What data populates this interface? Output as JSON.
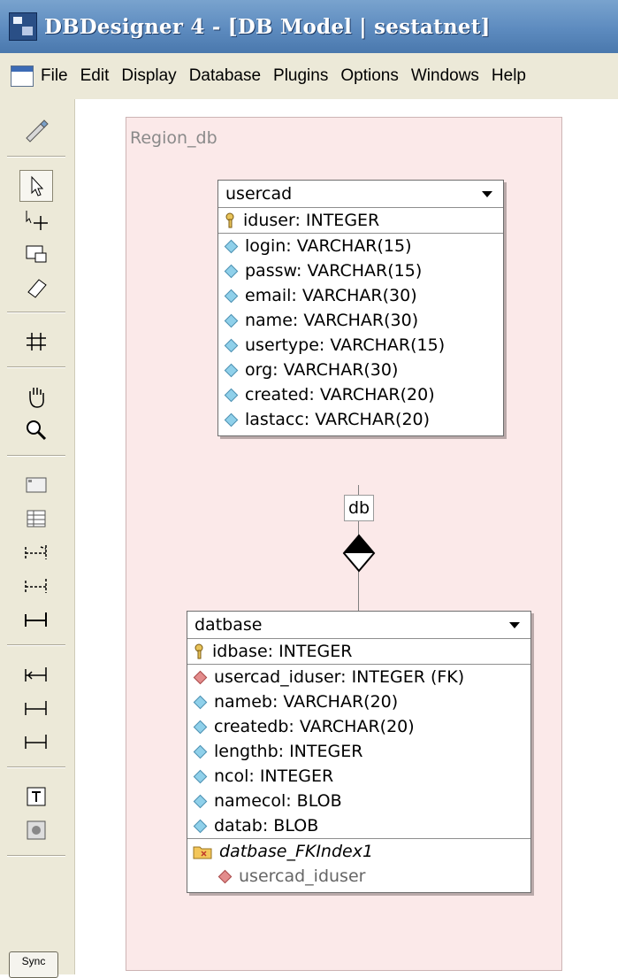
{
  "window": {
    "title": "DBDesigner 4 - [DB Model | sestatnet]"
  },
  "menu": [
    "File",
    "Edit",
    "Display",
    "Database",
    "Plugins",
    "Options",
    "Windows",
    "Help"
  ],
  "toolbar": {
    "tools": [
      "pen-icon",
      "pointer-icon",
      "move-icon",
      "resize-icon",
      "eraser-icon",
      "grid-icon",
      "hand-icon",
      "zoom-icon",
      "region-icon",
      "table-icon",
      "relation-1n-icon",
      "relation-1n-sub-icon",
      "relation-11-icon",
      "relation-nm-icon",
      "relation-1-1-sub-icon",
      "relation-link-icon",
      "note-icon",
      "image-icon"
    ],
    "sync_label": "Sync"
  },
  "region": {
    "label": "Region_db"
  },
  "tables": {
    "usercad": {
      "name": "usercad",
      "pk": "iduser: INTEGER",
      "columns": [
        "login: VARCHAR(15)",
        "passw: VARCHAR(15)",
        "email: VARCHAR(30)",
        "name: VARCHAR(30)",
        "usertype: VARCHAR(15)",
        "org: VARCHAR(30)",
        "created: VARCHAR(20)",
        "lastacc: VARCHAR(20)"
      ]
    },
    "datbase": {
      "name": "datbase",
      "pk": "idbase: INTEGER",
      "fk_column": "usercad_iduser: INTEGER (FK)",
      "columns": [
        "nameb: VARCHAR(20)",
        "createdb: VARCHAR(20)",
        "lengthb: INTEGER",
        "ncol: INTEGER",
        "namecol: BLOB",
        "datab: BLOB"
      ],
      "index_name": "datbase_FKIndex1",
      "index_column": "usercad_iduser"
    }
  },
  "relation": {
    "label": "db"
  },
  "colors": {
    "region_bg": "#fbe9e9",
    "titlebar": "#5d8bbf",
    "toolbar_bg": "#ece9d8"
  }
}
